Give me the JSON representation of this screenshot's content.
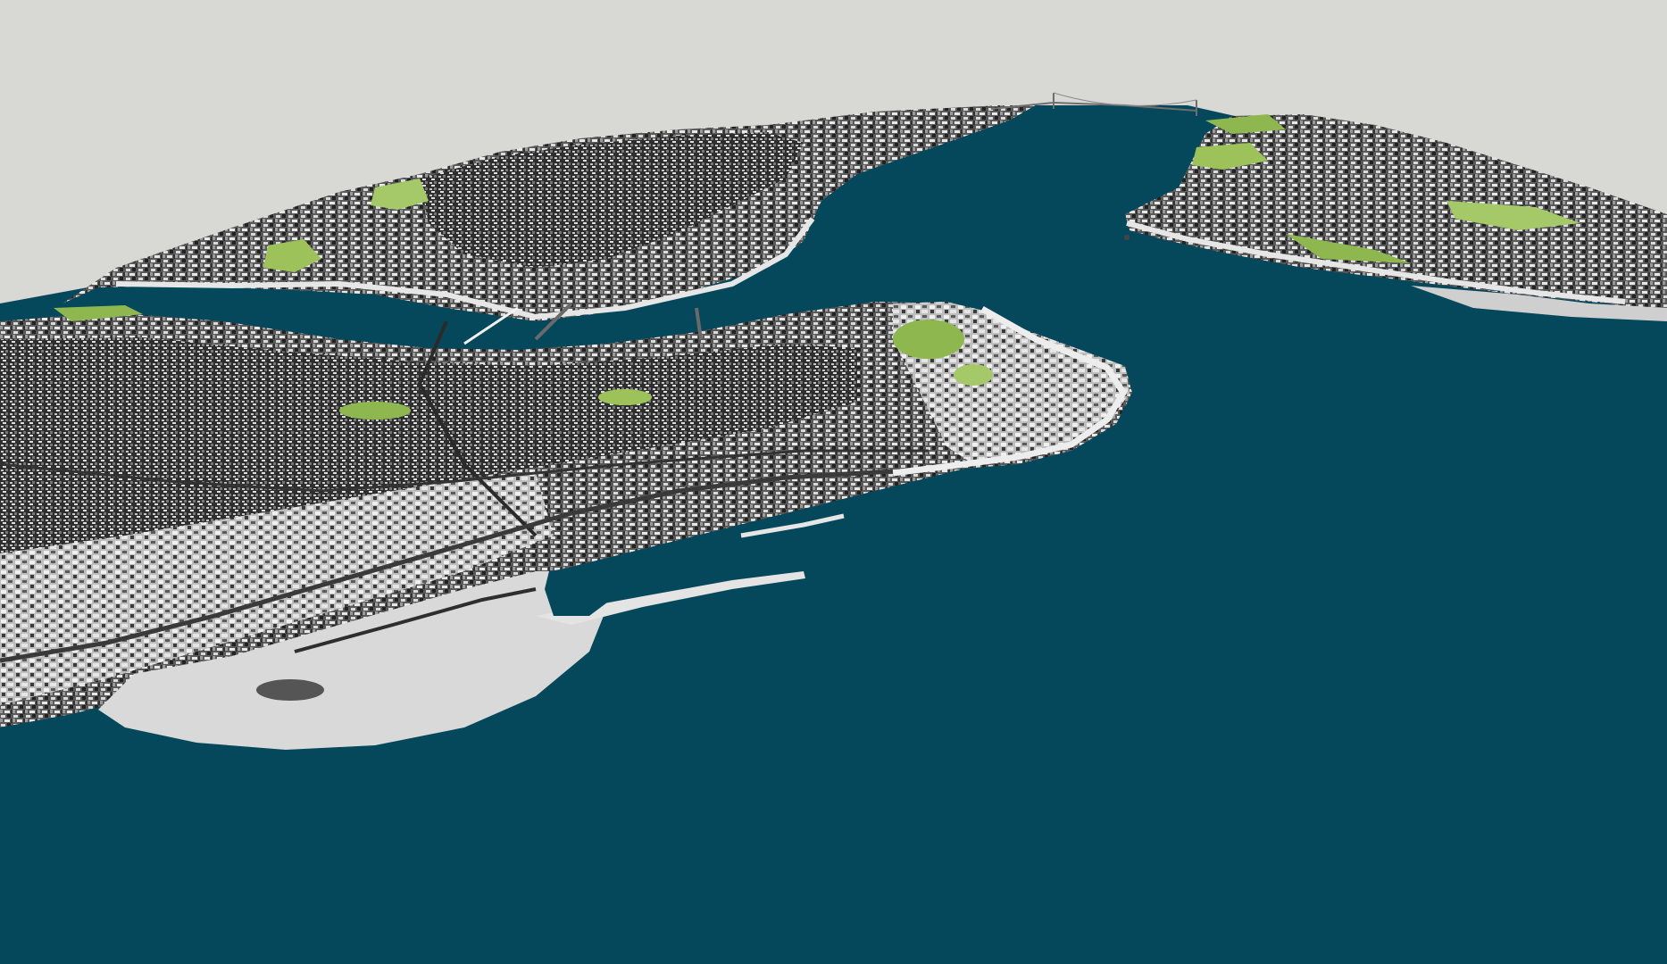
{
  "scene": {
    "description_visible_text": [],
    "colors": {
      "sky": "#d8d8d4",
      "water": "#06485b",
      "land": "#d9d9d9",
      "land_dense": "#3a3a3a",
      "park": "#9ec25a",
      "pier": "#e4e4e4",
      "bridge": "#707070"
    }
  }
}
